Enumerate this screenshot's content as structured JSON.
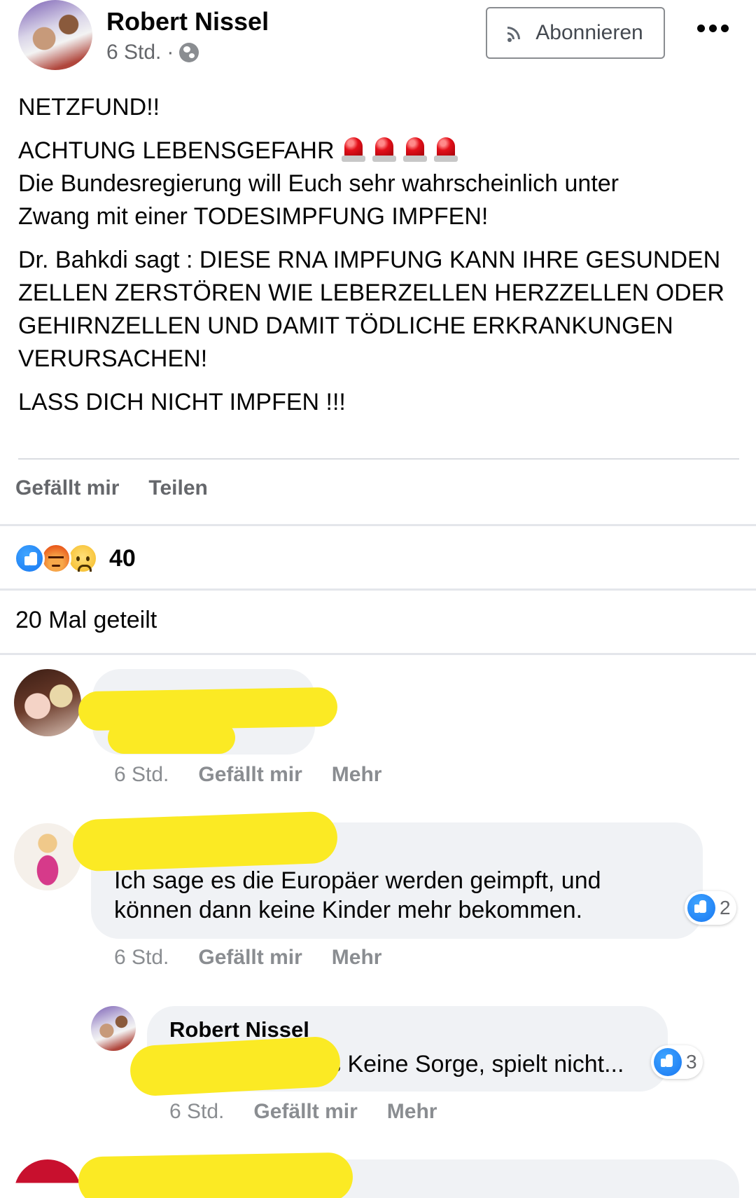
{
  "post": {
    "author": "Robert Nissel",
    "time": "6 Std.",
    "separator": "·",
    "subscribe_label": "Abonnieren",
    "paragraphs": {
      "p1": "NETZFUND!!",
      "p2_line1": "ACHTUNG LEBENSGEFAHR",
      "p2_line2": "Die Bundesregierung will Euch sehr wahrscheinlich unter",
      "p2_line3": "Zwang mit einer TODESIMPFUNG IMPFEN!",
      "p3_line1": "Dr. Bahkdi sagt : DIESE RNA IMPFUNG KANN IHRE GESUNDEN",
      "p3_line2": "ZELLEN ZERSTÖREN WIE LEBERZELLEN HERZZELLEN ODER",
      "p3_line3": "GEHIRNZELLEN UND DAMIT TÖDLICHE ERKRANKUNGEN",
      "p3_line4": "VERURSACHEN!",
      "p4": "LASS DICH NICHT IMPFEN !!!"
    },
    "siren_icons": [
      "siren-icon",
      "siren-icon",
      "siren-icon",
      "siren-icon"
    ],
    "actions": {
      "like": "Gefällt mir",
      "share": "Teilen"
    },
    "reactions": {
      "icons": [
        "like",
        "angry",
        "sad"
      ],
      "count": "40"
    },
    "shares": "20 Mal geteilt"
  },
  "comments": [
    {
      "redacted": true,
      "time": "6 Std.",
      "like": "Gefällt mir",
      "more": "Mehr"
    },
    {
      "redacted_name": true,
      "text_line1": "Ich sage es die Europäer werden geimpft, und",
      "text_line2": "können dann keine Kinder mehr bekommen.",
      "likes": "2",
      "time": "6 Std.",
      "like": "Gefällt mir",
      "more": "Mehr"
    },
    {
      "name": "Robert Nissel",
      "text_visible": "s Keine Sorge, spielt nicht...",
      "likes": "3",
      "time": "6 Std.",
      "like": "Gefällt mir",
      "more": "Mehr"
    }
  ],
  "colors": {
    "accent": "#1877f2",
    "scribble": "#fbea24",
    "bubble": "#f0f2f5",
    "muted_text": "#65676b",
    "siren_red": "#e3101a"
  }
}
